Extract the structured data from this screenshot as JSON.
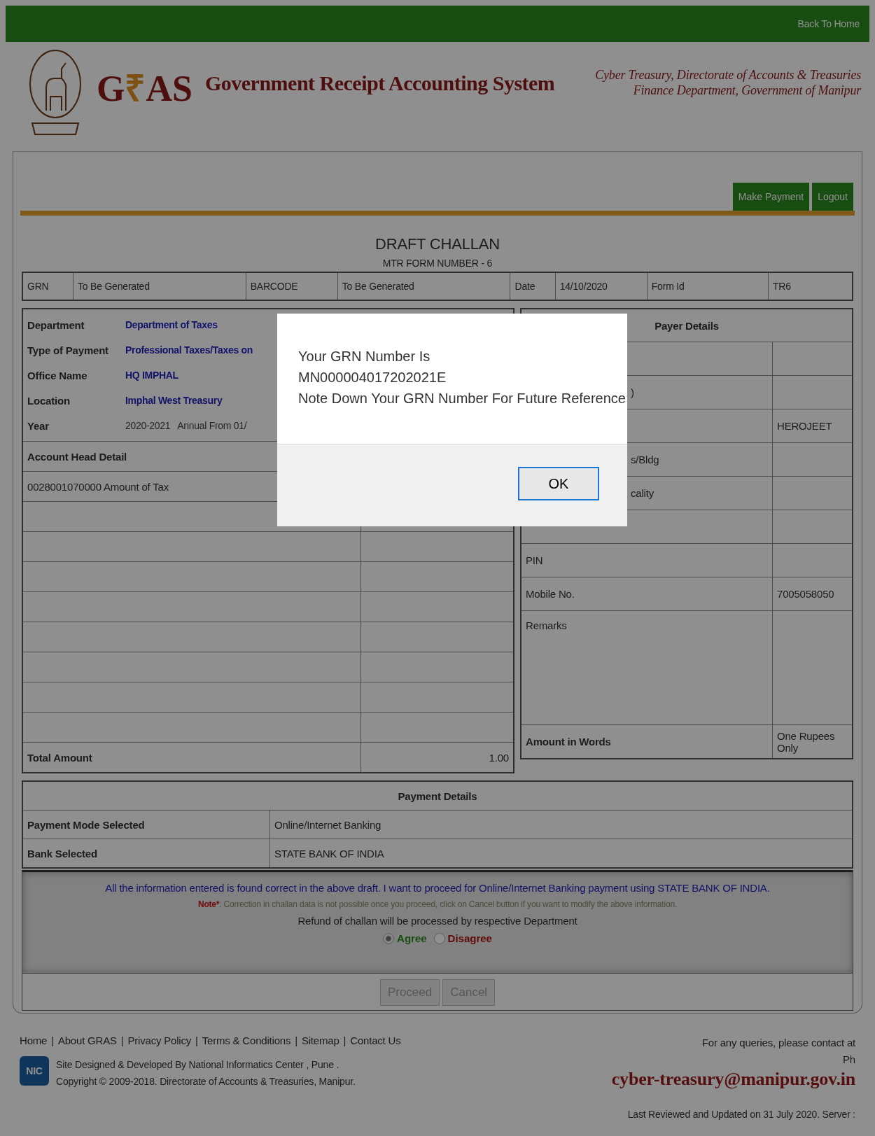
{
  "top_bar": {
    "link": "Back To Home"
  },
  "header": {
    "logo": "G₹AS",
    "title": "Government Receipt Accounting System",
    "org_lines": [
      "Cyber Treasury, Directorate of Accounts & Treasuries",
      "Finance Department, Government of Manipur"
    ]
  },
  "toolbar": {
    "buttons": [
      "Make Payment",
      "Logout"
    ]
  },
  "challan": {
    "title": "DRAFT CHALLAN",
    "subtitle": "MTR FORM NUMBER - 6",
    "summary": [
      "GRN",
      "To Be Generated",
      "BARCODE",
      "To Be Generated",
      "Date",
      "14/10/2020",
      "Form Id",
      "TR6"
    ],
    "info": [
      {
        "label": "Department",
        "value": "Department of Taxes"
      },
      {
        "label": "Type of Payment",
        "value": "Professional Taxes/Taxes on"
      },
      {
        "label": "Office Name",
        "value": "HQ IMPHAL"
      },
      {
        "label": "Location",
        "value": "Imphal West Treasury"
      },
      {
        "label": "Year",
        "value": "2020-2021   Annual From 01/"
      }
    ],
    "account_head": {
      "header": "Account Head Detail",
      "rows": [
        "0028001070000  Amount of Tax"
      ],
      "total_label": "Total Amount",
      "total_value": "1.00"
    },
    "payer": {
      "header": "Payer Details",
      "rows": [
        {
          "label": "",
          "value": ""
        },
        {
          "label": ")",
          "value": ""
        },
        {
          "label": "",
          "value": "HEROJEET"
        },
        {
          "label": "s/Bldg",
          "value": ""
        },
        {
          "label": "cality",
          "value": ""
        },
        {
          "label": "",
          "value": ""
        },
        {
          "label": "PIN",
          "value": ""
        },
        {
          "label": "Mobile No.",
          "value": "7005058050"
        },
        {
          "label": "Remarks",
          "value": "",
          "kind": "tall"
        },
        {
          "label": "Amount in Words",
          "value": "One Rupees Only",
          "kind": "bold"
        }
      ]
    },
    "payment": {
      "header": "Payment Details",
      "rows": [
        {
          "label": "Payment Mode Selected",
          "value": "Online/Internet Banking"
        },
        {
          "label": "Bank Selected",
          "value": "STATE BANK OF INDIA"
        }
      ]
    },
    "agreement": {
      "statement": "All the information entered is found correct in the above draft. I want to proceed for Online/Internet Banking payment using STATE BANK OF INDIA.",
      "note_label": "Note*",
      "note": ": Correction in challan data is not possible once you proceed, click on Cancel button if you want to modify the above information.",
      "refund": "Refund of challan will be processed by respective Department",
      "options": [
        {
          "label": "Agree",
          "selected": true
        },
        {
          "label": "Disagree",
          "selected": false
        }
      ]
    },
    "actions": [
      {
        "label": "Proceed",
        "disabled": true
      },
      {
        "label": "Cancel",
        "disabled": true
      }
    ]
  },
  "footer": {
    "links": [
      "Home",
      "About GRAS",
      "Privacy Policy",
      "Terms & Conditions",
      "Sitemap",
      "Contact Us"
    ],
    "separator": "|",
    "nic_logo": "NIC",
    "credits": [
      "Site Designed & Developed By National Informatics Center , Pune .",
      "Copyright © 2009-2018. Directorate of Accounts & Treasuries, Manipur."
    ],
    "contact": "For any queries, please contact at",
    "phone_label": "Ph",
    "email": "cyber-treasury@manipur.gov.in",
    "updated": "Last Reviewed and Updated on 31 July 2020. Server :"
  },
  "dialog": {
    "lines": [
      "Your GRN Number Is",
      "MN000004017202021E",
      "Note Down Your GRN Number For Future Reference"
    ],
    "button": "OK"
  }
}
